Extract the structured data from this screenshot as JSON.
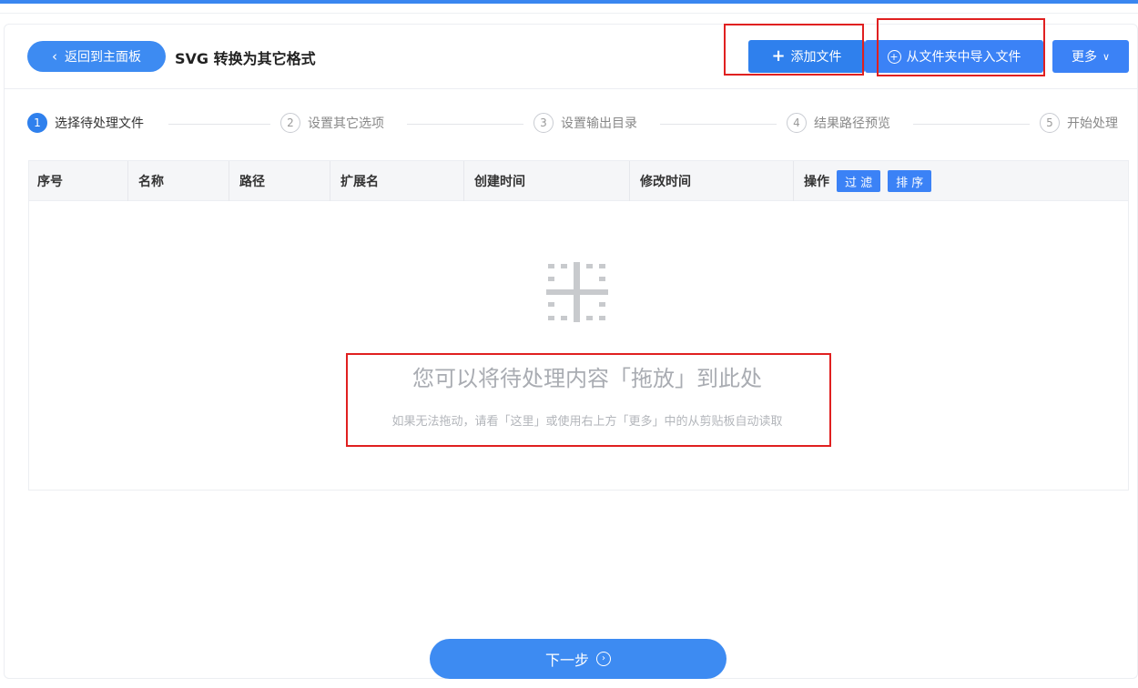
{
  "header": {
    "back_label": "返回到主面板",
    "title": "SVG 转换为其它格式",
    "add_file_label": "添加文件",
    "import_folder_label": "从文件夹中导入文件",
    "more_label": "更多"
  },
  "steps": [
    {
      "num": "1",
      "label": "选择待处理文件",
      "active": true
    },
    {
      "num": "2",
      "label": "设置其它选项",
      "active": false
    },
    {
      "num": "3",
      "label": "设置输出目录",
      "active": false
    },
    {
      "num": "4",
      "label": "结果路径预览",
      "active": false
    },
    {
      "num": "5",
      "label": "开始处理",
      "active": false
    }
  ],
  "table": {
    "columns": [
      "序号",
      "名称",
      "路径",
      "扩展名",
      "创建时间",
      "修改时间",
      "操作"
    ],
    "filter_label": "过 滤",
    "sort_label": "排 序",
    "rows": []
  },
  "dropzone": {
    "main_text": "您可以将待处理内容「拖放」到此处",
    "sub_text": "如果无法拖动，请看「这里」或使用右上方「更多」中的从剪贴板自动读取"
  },
  "footer": {
    "next_label": "下一步"
  },
  "icons": {
    "back": "chevron-left-icon",
    "add": "plus-icon",
    "import": "circle-plus-icon",
    "more": "chevron-down-icon",
    "drop": "drop-target-icon",
    "next": "circle-arrow-right-icon"
  },
  "colors": {
    "primary": "#3d8bf2",
    "annotation_red": "#e02020"
  }
}
